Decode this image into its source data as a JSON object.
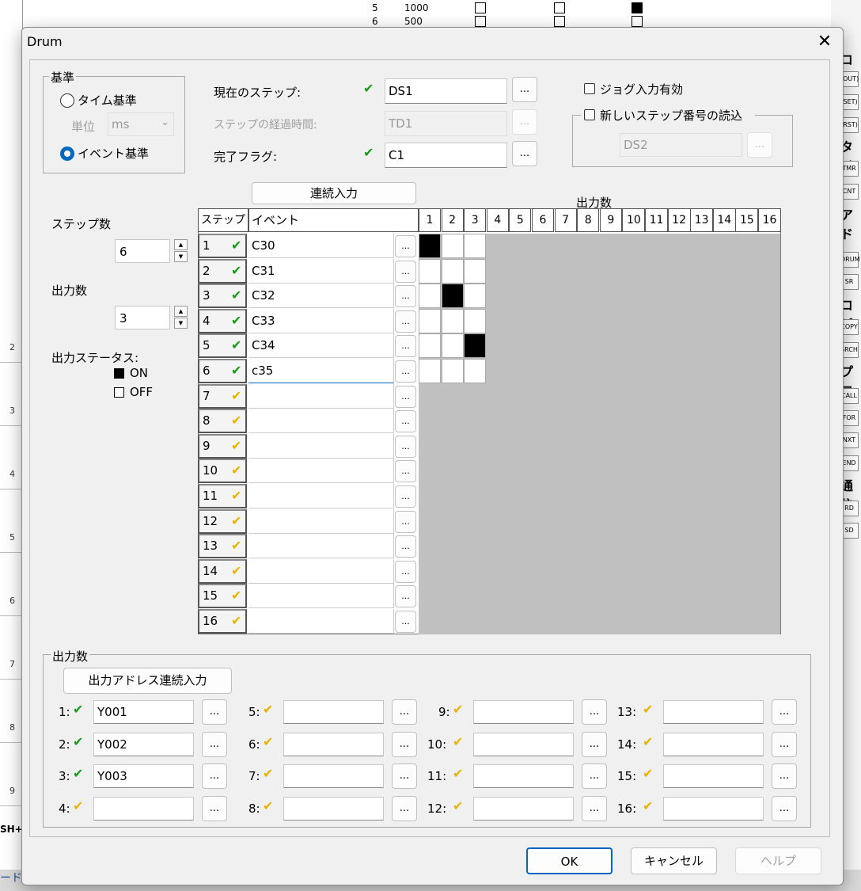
{
  "dialog": {
    "title": "Drum",
    "close_glyph": "✕",
    "basis": {
      "legend": "基準",
      "time_label": "タイム基準",
      "unit_label": "単位",
      "unit_value": "ms",
      "event_label": "イベント基準",
      "selected": "event"
    },
    "current_step": {
      "label": "現在のステップ:",
      "value": "DS1"
    },
    "elapsed_time": {
      "label": "ステップの経過時間:",
      "value": "TD1"
    },
    "done_flag": {
      "label": "完了フラグ:",
      "value": "C1"
    },
    "jog_enable": {
      "label": "ジョグ入力有効",
      "checked": false
    },
    "new_step": {
      "label": "新しいステップ番号の読込",
      "checked": false,
      "value": "DS2"
    },
    "continuous_button": "連続入力",
    "output_count_header": "出力数",
    "step_count": {
      "label": "ステップ数",
      "value": "6"
    },
    "output_count": {
      "label": "出力数",
      "value": "3"
    },
    "output_status": {
      "label": "出力ステータス:",
      "on_label": "ON",
      "off_label": "OFF"
    },
    "grid": {
      "step_header": "ステップ",
      "event_header": "イベント",
      "output_headers": [
        "1",
        "2",
        "3",
        "4",
        "5",
        "6",
        "7",
        "8",
        "9",
        "10",
        "11",
        "12",
        "13",
        "14",
        "15",
        "16"
      ],
      "rows": [
        {
          "step": "1",
          "event": "C30",
          "ok": true,
          "outputs": [
            1,
            0,
            0
          ]
        },
        {
          "step": "2",
          "event": "C31",
          "ok": true,
          "outputs": [
            0,
            0,
            0
          ]
        },
        {
          "step": "3",
          "event": "C32",
          "ok": true,
          "outputs": [
            0,
            1,
            0
          ]
        },
        {
          "step": "4",
          "event": "C33",
          "ok": true,
          "outputs": [
            0,
            0,
            0
          ]
        },
        {
          "step": "5",
          "event": "C34",
          "ok": true,
          "outputs": [
            0,
            0,
            1
          ]
        },
        {
          "step": "6",
          "event": "c35",
          "ok": true,
          "outputs": [
            0,
            0,
            0
          ]
        },
        {
          "step": "7",
          "event": "",
          "ok": false
        },
        {
          "step": "8",
          "event": "",
          "ok": false
        },
        {
          "step": "9",
          "event": "",
          "ok": false
        },
        {
          "step": "10",
          "event": "",
          "ok": false
        },
        {
          "step": "11",
          "event": "",
          "ok": false
        },
        {
          "step": "12",
          "event": "",
          "ok": false
        },
        {
          "step": "13",
          "event": "",
          "ok": false
        },
        {
          "step": "14",
          "event": "",
          "ok": false
        },
        {
          "step": "15",
          "event": "",
          "ok": false
        },
        {
          "step": "16",
          "event": "",
          "ok": false
        }
      ]
    },
    "outputs": {
      "legend": "出力数",
      "continuous_address_button": "出力アドレス連続入力",
      "items": [
        {
          "label": "1:",
          "value": "Y001",
          "ok": true
        },
        {
          "label": "2:",
          "value": "Y002",
          "ok": true
        },
        {
          "label": "3:",
          "value": "Y003",
          "ok": true
        },
        {
          "label": "4:",
          "value": "",
          "ok": false
        },
        {
          "label": "5:",
          "value": "",
          "ok": false
        },
        {
          "label": "6:",
          "value": "",
          "ok": false
        },
        {
          "label": "7:",
          "value": "",
          "ok": false
        },
        {
          "label": "8:",
          "value": "",
          "ok": false
        },
        {
          "label": "9:",
          "value": "",
          "ok": false
        },
        {
          "label": "10:",
          "value": "",
          "ok": false
        },
        {
          "label": "11:",
          "value": "",
          "ok": false
        },
        {
          "label": "12:",
          "value": "",
          "ok": false
        },
        {
          "label": "13:",
          "value": "",
          "ok": false
        },
        {
          "label": "14:",
          "value": "",
          "ok": false
        },
        {
          "label": "15:",
          "value": "",
          "ok": false
        },
        {
          "label": "16:",
          "value": "",
          "ok": false
        }
      ]
    },
    "buttons": {
      "ok": "OK",
      "cancel": "キャンセル",
      "help": "ヘルプ"
    },
    "ellipsis": "..."
  },
  "background": {
    "rows": [
      "2",
      "3",
      "4",
      "5",
      "6",
      "7",
      "8",
      "9"
    ],
    "top_cells": [
      {
        "a": "5",
        "b": "1000"
      },
      {
        "a": "6",
        "b": "500"
      }
    ],
    "palette": [
      "コイ",
      "タイ",
      "アド",
      "コピ",
      "プロ",
      "通信"
    ],
    "palette_icons": [
      "(OUT)",
      "(SET)",
      "(RST)",
      "TMR",
      "CNT",
      "DRUM",
      "SR",
      "COPY",
      "SRCH",
      "CALL",
      "FOR",
      "NXT",
      "END",
      "RD",
      "SD"
    ],
    "left_bottom": "ード",
    "left_bottom2": "SH+F"
  },
  "colors": {
    "check_green": "#1a9a1a",
    "check_yellow": "#e6b400",
    "focus_blue": "#0067c0"
  }
}
